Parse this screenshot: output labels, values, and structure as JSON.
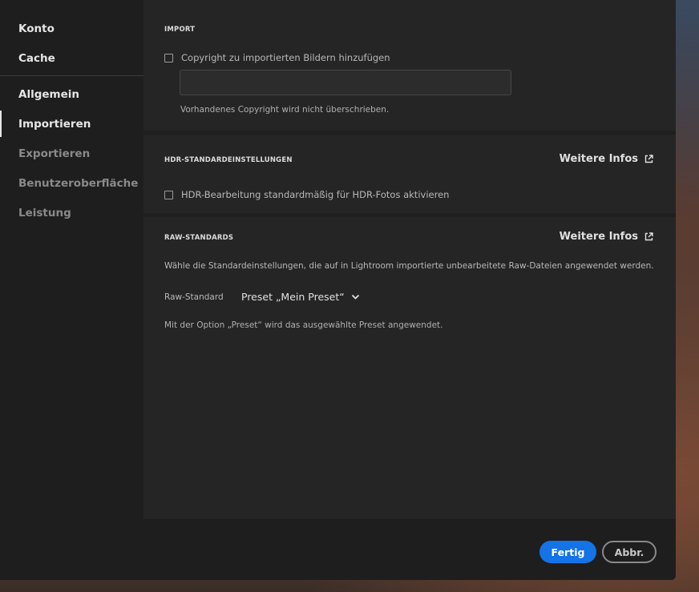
{
  "sidebar": {
    "items": [
      {
        "label": "Konto"
      },
      {
        "label": "Cache"
      },
      {
        "label": "Allgemein"
      },
      {
        "label": "Importieren"
      },
      {
        "label": "Exportieren"
      },
      {
        "label": "Benutzeroberfläche"
      },
      {
        "label": "Leistung"
      }
    ],
    "active": "Importieren"
  },
  "import_section": {
    "title": "IMPORT",
    "copyright_checkbox_label": "Copyright zu importierten Bildern hinzufügen",
    "copyright_checked": false,
    "copyright_value": "",
    "helper": "Vorhandenes Copyright wird nicht überschrieben."
  },
  "hdr_section": {
    "title": "HDR-STANDARDEINSTELLUNGEN",
    "more_info": "Weitere Infos",
    "checkbox_label": "HDR-Bearbeitung standardmäßig für HDR-Fotos aktivieren",
    "checked": false
  },
  "raw_section": {
    "title": "RAW-STANDARDS",
    "more_info": "Weitere Infos",
    "description": "Wähle die Standardeinstellungen, die auf in Lightroom importierte unbearbeitete Raw-Dateien angewendet werden.",
    "raw_label": "Raw-Standard",
    "raw_value": "Preset „Mein Preset“",
    "helper": "Mit der Option „Preset“ wird das ausgewählte Preset angewendet."
  },
  "footer": {
    "done_label": "Fertig",
    "cancel_label": "Abbr."
  },
  "colors": {
    "accent": "#1473e6",
    "dialog_bg": "#1e1e1e",
    "panel_bg": "#252525"
  }
}
